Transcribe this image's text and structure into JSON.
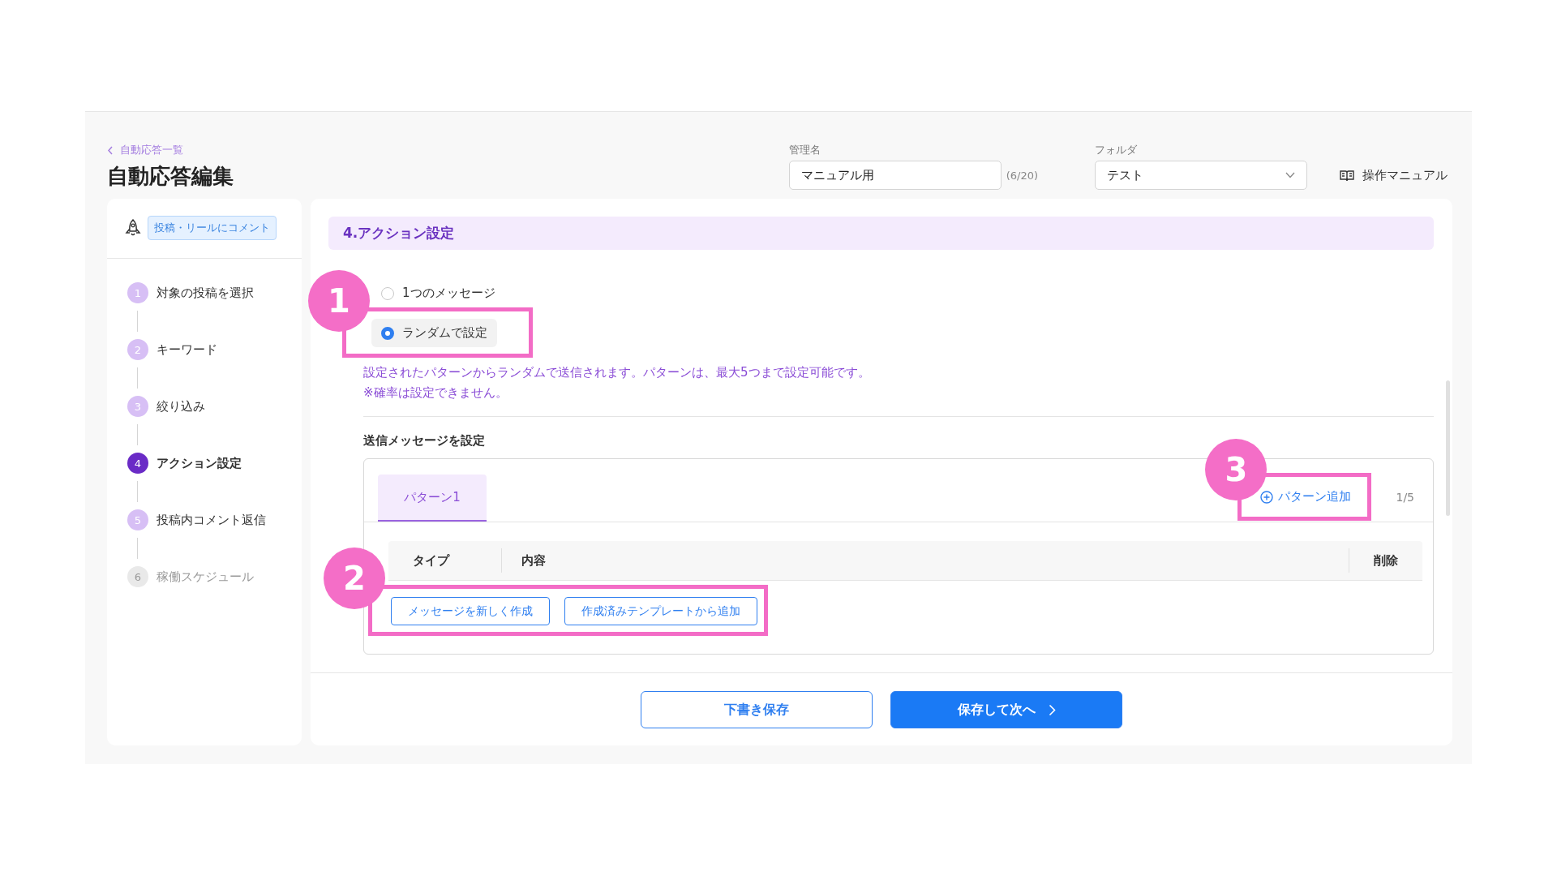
{
  "breadcrumb": "自動応答一覧",
  "title": "自動応答編集",
  "name_field": {
    "label": "管理名",
    "value": "マニュアル用",
    "counter": "(6/20)"
  },
  "folder_field": {
    "label": "フォルダ",
    "value": "テスト"
  },
  "manual_link": "操作マニュアル",
  "trigger_tag": "投稿・リールにコメント",
  "steps": [
    {
      "number": "1",
      "label": "対象の投稿を選択",
      "selected": false,
      "disabled": false
    },
    {
      "number": "2",
      "label": "キーワード",
      "selected": false,
      "disabled": false
    },
    {
      "number": "3",
      "label": "絞り込み",
      "selected": false,
      "disabled": false
    },
    {
      "number": "4",
      "label": "アクション設定",
      "selected": true,
      "disabled": false
    },
    {
      "number": "5",
      "label": "投稿内コメント返信",
      "selected": false,
      "disabled": false
    },
    {
      "number": "6",
      "label": "稼働スケジュール",
      "selected": false,
      "disabled": true
    }
  ],
  "section_title": "4.アクション設定",
  "send_modes": [
    {
      "label": "1つのメッセージ",
      "selected": false
    },
    {
      "label": "ランダムで設定",
      "selected": true
    }
  ],
  "notes": [
    "設定されたパターンからランダムで送信されます。パターンは、最大5つまで設定可能です。",
    "※確率は設定できません。"
  ],
  "message_heading": "送信メッセージを設定",
  "pattern_tabs": [
    {
      "label": "パターン1",
      "selected": true
    }
  ],
  "add_pattern": "パターン追加",
  "pattern_count": "1/5",
  "table_columns": [
    "タイプ",
    "内容",
    "削除"
  ],
  "add_buttons": [
    "メッセージを新しく作成",
    "作成済みテンプレートから追加"
  ],
  "footer_buttons": [
    {
      "label": "下書き保存",
      "kind": "secondary"
    },
    {
      "label": "保存して次へ",
      "kind": "primary"
    }
  ],
  "callouts": [
    "1",
    "2",
    "3"
  ]
}
